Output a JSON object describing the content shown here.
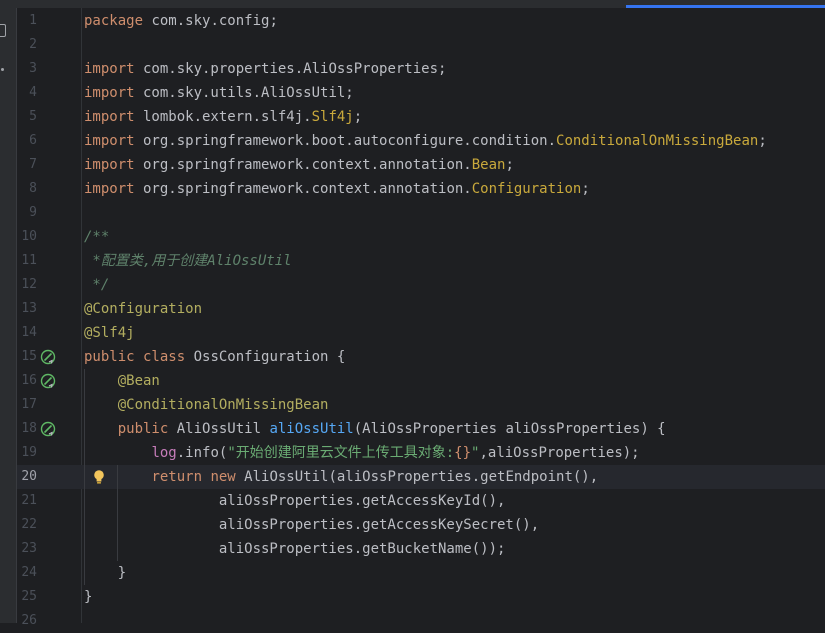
{
  "editor": {
    "lines": [
      {
        "n": "1",
        "tokens": [
          {
            "t": "kw",
            "v": "package"
          },
          {
            "t": "p",
            "v": " com.sky.config;"
          }
        ]
      },
      {
        "n": "2",
        "tokens": []
      },
      {
        "n": "3",
        "tokens": [
          {
            "t": "kw",
            "v": "import"
          },
          {
            "t": "p",
            "v": " com.sky.properties.AliOssProperties;"
          }
        ]
      },
      {
        "n": "4",
        "tokens": [
          {
            "t": "kw",
            "v": "import"
          },
          {
            "t": "p",
            "v": " com.sky.utils.AliOssUtil;"
          }
        ]
      },
      {
        "n": "5",
        "tokens": [
          {
            "t": "kw",
            "v": "import"
          },
          {
            "t": "p",
            "v": " lombok.extern.slf4j."
          },
          {
            "t": "cond",
            "v": "Slf4j"
          },
          {
            "t": "p",
            "v": ";"
          }
        ]
      },
      {
        "n": "6",
        "tokens": [
          {
            "t": "kw",
            "v": "import"
          },
          {
            "t": "p",
            "v": " org.springframework.boot.autoconfigure.condition."
          },
          {
            "t": "cond",
            "v": "ConditionalOnMissingBean"
          },
          {
            "t": "p",
            "v": ";"
          }
        ]
      },
      {
        "n": "7",
        "tokens": [
          {
            "t": "kw",
            "v": "import"
          },
          {
            "t": "p",
            "v": " org.springframework.context.annotation."
          },
          {
            "t": "cond",
            "v": "Bean"
          },
          {
            "t": "p",
            "v": ";"
          }
        ]
      },
      {
        "n": "8",
        "tokens": [
          {
            "t": "kw",
            "v": "import"
          },
          {
            "t": "p",
            "v": " org.springframework.context.annotation."
          },
          {
            "t": "cond",
            "v": "Configuration"
          },
          {
            "t": "p",
            "v": ";"
          }
        ]
      },
      {
        "n": "9",
        "tokens": []
      },
      {
        "n": "10",
        "tokens": [
          {
            "t": "doc",
            "v": "/**"
          }
        ]
      },
      {
        "n": "11",
        "tokens": [
          {
            "t": "doc",
            "v": " *配置类,用于创建AliOssUtil"
          }
        ]
      },
      {
        "n": "12",
        "tokens": [
          {
            "t": "doc",
            "v": " */"
          }
        ]
      },
      {
        "n": "13",
        "tokens": [
          {
            "t": "ann",
            "v": "@Configuration"
          }
        ]
      },
      {
        "n": "14",
        "tokens": [
          {
            "t": "ann",
            "v": "@Slf4j"
          }
        ]
      },
      {
        "n": "15",
        "icon": "bean-config-icon",
        "tokens": [
          {
            "t": "kw",
            "v": "public class"
          },
          {
            "t": "p",
            "v": " OssConfiguration {"
          }
        ]
      },
      {
        "n": "16",
        "icon": "bean-method-icon",
        "tokens": [
          {
            "t": "p",
            "v": "    "
          },
          {
            "t": "ann",
            "v": "@Bean"
          }
        ]
      },
      {
        "n": "17",
        "tokens": [
          {
            "t": "p",
            "v": "    "
          },
          {
            "t": "ann",
            "v": "@ConditionalOnMissingBean"
          }
        ]
      },
      {
        "n": "18",
        "icon": "bean-return-icon",
        "tokens": [
          {
            "t": "p",
            "v": "    "
          },
          {
            "t": "kw",
            "v": "public"
          },
          {
            "t": "p",
            "v": " AliOssUtil "
          },
          {
            "t": "fn",
            "v": "aliOssUtil"
          },
          {
            "t": "p",
            "v": "(AliOssProperties aliOssProperties) {"
          }
        ]
      },
      {
        "n": "19",
        "tokens": [
          {
            "t": "p",
            "v": "        "
          },
          {
            "t": "field",
            "v": "log"
          },
          {
            "t": "p",
            "v": ".info("
          },
          {
            "t": "str",
            "v": "\"开始创建阿里云文件上传工具对象:"
          },
          {
            "t": "fmt",
            "v": "{}"
          },
          {
            "t": "str",
            "v": "\""
          },
          {
            "t": "p",
            "v": ",aliOssProperties);"
          }
        ]
      },
      {
        "n": "20",
        "current": true,
        "bulb": true,
        "tokens": [
          {
            "t": "p",
            "v": "        "
          },
          {
            "t": "kw",
            "v": "return new"
          },
          {
            "t": "p",
            "v": " AliOssUtil(aliOssProperties.getEndpoint(),"
          }
        ]
      },
      {
        "n": "21",
        "tokens": [
          {
            "t": "p",
            "v": "                aliOssProperties.getAccessKeyId(),"
          }
        ]
      },
      {
        "n": "22",
        "tokens": [
          {
            "t": "p",
            "v": "                aliOssProperties.getAccessKeySecret(),"
          }
        ]
      },
      {
        "n": "23",
        "tokens": [
          {
            "t": "p",
            "v": "                aliOssProperties.getBucketName());"
          }
        ]
      },
      {
        "n": "24",
        "tokens": [
          {
            "t": "p",
            "v": "    }"
          }
        ]
      },
      {
        "n": "25",
        "tokens": [
          {
            "t": "p",
            "v": "}"
          }
        ]
      },
      {
        "n": "26",
        "tokens": []
      }
    ]
  },
  "colors": {
    "background": "#1e1f22",
    "keyword": "#cf8e6d",
    "annotation": "#b3ae60",
    "method": "#56a8f5",
    "string": "#6aab73",
    "comment": "#5f826b",
    "accent": "#3574f0"
  }
}
